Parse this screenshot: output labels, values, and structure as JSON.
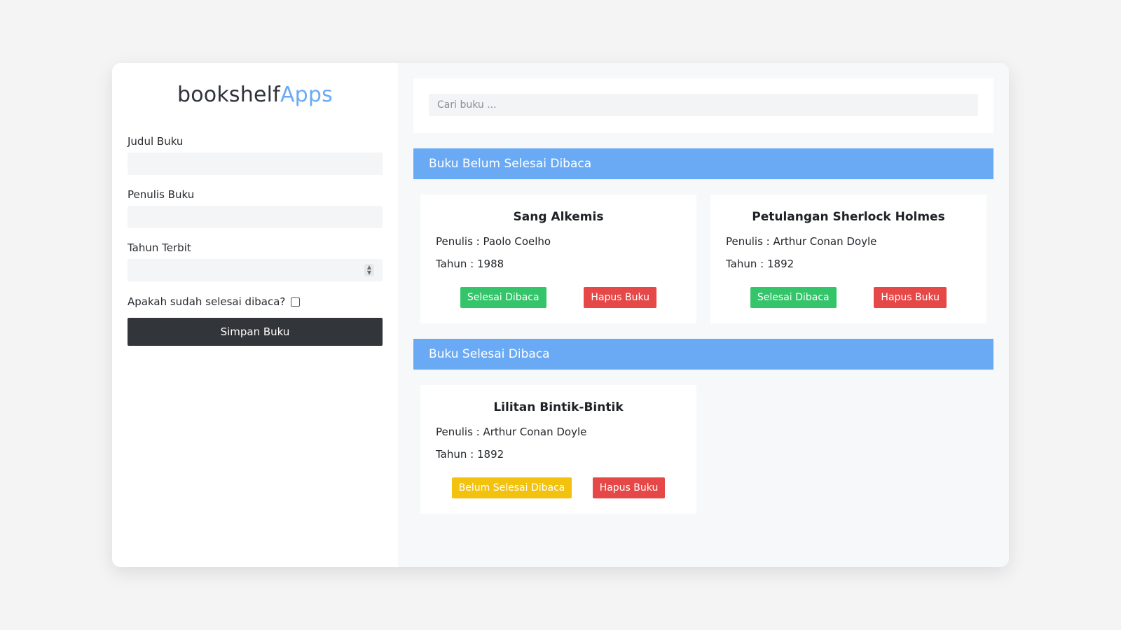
{
  "brand": {
    "part1": "bookshelf",
    "part2": "Apps"
  },
  "form": {
    "title_label": "Judul Buku",
    "author_label": "Penulis Buku",
    "year_label": "Tahun Terbit",
    "finished_label": "Apakah sudah selesai dibaca?",
    "save_label": "Simpan Buku",
    "title_value": "",
    "author_value": "",
    "year_value": ""
  },
  "search": {
    "placeholder": "Cari buku ..."
  },
  "sections": {
    "unfinished": {
      "title": "Buku Belum Selesai Dibaca"
    },
    "finished": {
      "title": "Buku Selesai Dibaca"
    }
  },
  "unfinished_books": [
    {
      "title": "Sang Alkemis",
      "author": "Penulis : Paolo Coelho",
      "year": "Tahun : 1988",
      "primary_action": "Selesai Dibaca",
      "delete_action": "Hapus Buku"
    },
    {
      "title": "Petulangan Sherlock Holmes",
      "author": "Penulis : Arthur Conan Doyle",
      "year": "Tahun : 1892",
      "primary_action": "Selesai Dibaca",
      "delete_action": "Hapus Buku"
    }
  ],
  "finished_books": [
    {
      "title": "Lilitan Bintik-Bintik",
      "author": "Penulis : Arthur Conan Doyle",
      "year": "Tahun : 1892",
      "primary_action": "Belum Selesai Dibaca",
      "delete_action": "Hapus Buku"
    }
  ],
  "colors": {
    "accent": "#6aaaf4",
    "dark_button": "#323539",
    "done_button": "#34c46a",
    "undone_button": "#f3c20f",
    "delete_button": "#e64848"
  }
}
